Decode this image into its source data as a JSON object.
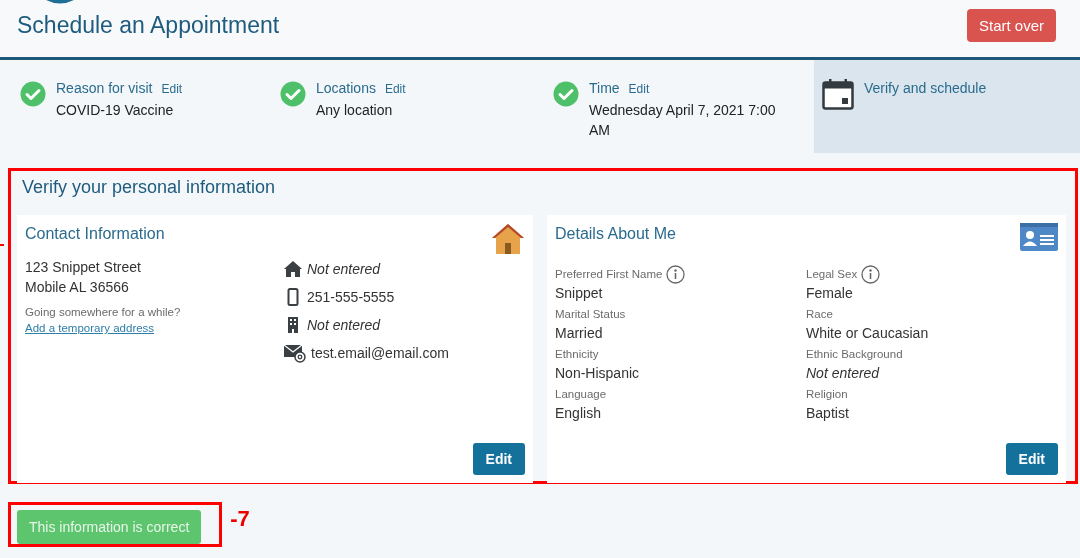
{
  "header": {
    "title": "Schedule an Appointment",
    "start_over": "Start over"
  },
  "steps": [
    {
      "label": "Reason for visit",
      "edit": "Edit",
      "value": "COVID-19 Vaccine",
      "completed": true,
      "selected": false
    },
    {
      "label": "Locations",
      "edit": "Edit",
      "value": "Any location",
      "completed": true,
      "selected": false
    },
    {
      "label": "Time",
      "edit": "Edit",
      "value": "Wednesday April 7, 2021 7:00 AM",
      "completed": true,
      "selected": false
    },
    {
      "label": "Verify and schedule",
      "completed": false,
      "selected": true
    }
  ],
  "section": {
    "title": "Verify your personal information"
  },
  "contact_card": {
    "title": "Contact Information",
    "address": [
      "123 Snippet Street",
      "Mobile AL 36566"
    ],
    "away_prompt": "Going somewhere for a while?",
    "temp_link": "Add a temporary address",
    "rows": [
      {
        "kind": "home",
        "value": "Not entered",
        "empty": true
      },
      {
        "kind": "mobile",
        "value": "251-555-5555",
        "empty": false
      },
      {
        "kind": "work",
        "value": "Not entered",
        "empty": true
      },
      {
        "kind": "email",
        "value": "test.email@email.com",
        "empty": false
      }
    ],
    "edit": "Edit"
  },
  "details_card": {
    "title": "Details About Me",
    "fields": [
      {
        "label": "Preferred First Name",
        "value": "Snippet",
        "info": true,
        "empty": false
      },
      {
        "label": "Legal Sex",
        "value": "Female",
        "info": true,
        "empty": false
      },
      {
        "label": "Marital Status",
        "value": "Married",
        "info": false,
        "empty": false
      },
      {
        "label": "Race",
        "value": "White or Caucasian",
        "info": false,
        "empty": false
      },
      {
        "label": "Ethnicity",
        "value": "Non-Hispanic",
        "info": false,
        "empty": false
      },
      {
        "label": "Ethnic Background",
        "value": "Not entered",
        "info": false,
        "empty": true
      },
      {
        "label": "Language",
        "value": "English",
        "info": false,
        "empty": false
      },
      {
        "label": "Religion",
        "value": "Baptist",
        "info": false,
        "empty": false
      }
    ],
    "edit": "Edit"
  },
  "confirm_button": {
    "label": "This information is correct",
    "disabled": true
  },
  "annotation": {
    "label": "-7"
  }
}
